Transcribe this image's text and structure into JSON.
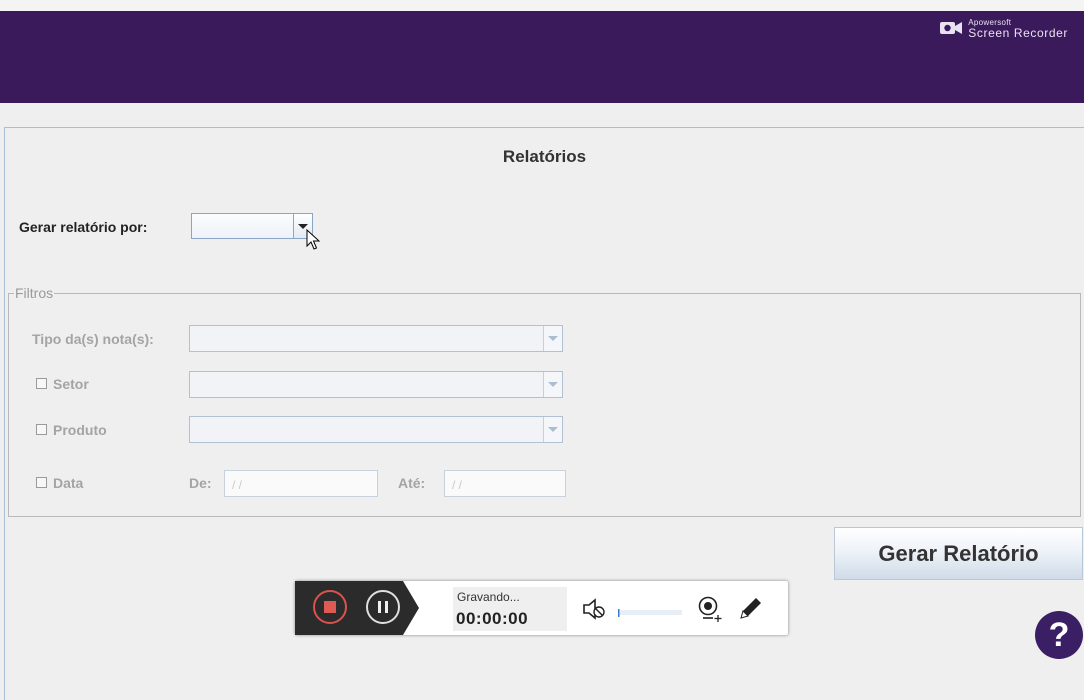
{
  "brand": {
    "small": "Apowersoft",
    "name": "Screen Recorder"
  },
  "page": {
    "title": "Relatórios"
  },
  "report": {
    "label": "Gerar relatório por:",
    "selected": ""
  },
  "filters": {
    "legend": "Filtros",
    "tipo_label": "Tipo da(s) nota(s):",
    "setor_label": "Setor",
    "produto_label": "Produto",
    "data_label": "Data",
    "de_label": "De:",
    "ate_label": "Até:",
    "de_value": "/ /",
    "ate_value": "/ /"
  },
  "button": {
    "generate": "Gerar Relatório"
  },
  "recorder": {
    "status": "Gravando...",
    "time": "00:00:00"
  },
  "help": {
    "label": "?"
  },
  "colors": {
    "header": "#3b1a5c",
    "help": "#3b1f64",
    "stop": "#e05a55"
  }
}
